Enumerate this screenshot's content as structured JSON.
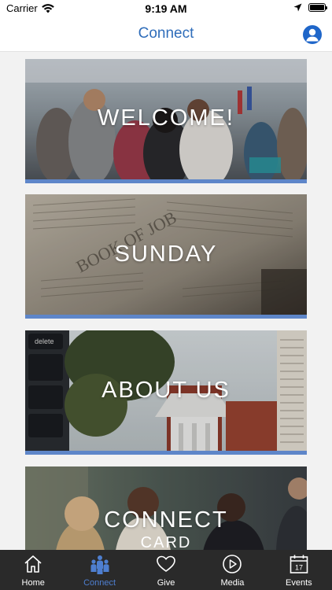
{
  "status_bar": {
    "carrier": "Carrier",
    "time": "9:19 AM"
  },
  "header": {
    "title": "Connect",
    "accent_color": "#2f6dba"
  },
  "tiles": [
    {
      "label": "WELCOME!",
      "sub": ""
    },
    {
      "label": "SUNDAY",
      "sub": ""
    },
    {
      "label": "ABOUT US",
      "sub": ""
    },
    {
      "label": "CONNECT",
      "sub": "CARD"
    }
  ],
  "tab_bar": {
    "tabs": [
      {
        "label": "Home",
        "icon": "house-icon",
        "active": false
      },
      {
        "label": "Connect",
        "icon": "people-icon",
        "active": true
      },
      {
        "label": "Give",
        "icon": "heart-icon",
        "active": false
      },
      {
        "label": "Media",
        "icon": "play-icon",
        "active": false
      },
      {
        "label": "Events",
        "icon": "calendar-icon",
        "active": false
      }
    ],
    "calendar_day": "17",
    "active_color": "#4e7fd0"
  }
}
